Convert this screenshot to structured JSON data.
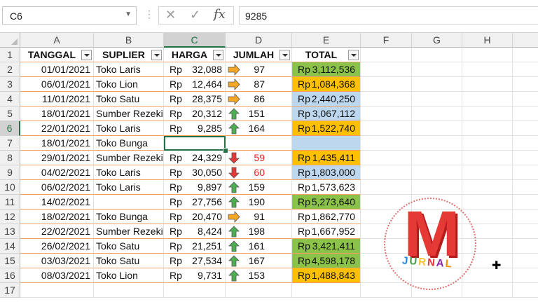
{
  "formula_bar": {
    "name_box": "C6",
    "formula_value": "9285",
    "fx_label": "fx",
    "cancel_icon": "x-icon",
    "enter_icon": "check-icon"
  },
  "columns": [
    "A",
    "B",
    "C",
    "D",
    "E",
    "F",
    "G",
    "H"
  ],
  "rows": [
    "1",
    "2",
    "3",
    "4",
    "5",
    "6",
    "7",
    "8",
    "9",
    "10",
    "11",
    "12",
    "13",
    "14",
    "15",
    "16",
    "17"
  ],
  "headers": {
    "tanggal": "TANGGAL",
    "suplier": "SUPLIER",
    "harga": "HARGA",
    "jumlah": "JUMLAH",
    "total": "TOTAL"
  },
  "currency": "Rp",
  "records": [
    {
      "tanggal": "01/01/2021",
      "suplier": "Toko Laris",
      "harga": "32,088",
      "arrow": "right",
      "jumlah": "97",
      "total": "3,112,536",
      "fill": "green"
    },
    {
      "tanggal": "06/01/2021",
      "suplier": "Toko Lion",
      "harga": "12,464",
      "arrow": "right",
      "jumlah": "87",
      "total": "1,084,368",
      "fill": "orange"
    },
    {
      "tanggal": "11/01/2021",
      "suplier": "Toko Satu",
      "harga": "28,375",
      "arrow": "right",
      "jumlah": "86",
      "total": "2,440,250",
      "fill": "blue"
    },
    {
      "tanggal": "18/01/2021",
      "suplier": "Sumber Rezeki",
      "harga": "20,312",
      "arrow": "up",
      "jumlah": "151",
      "total": "3,067,112",
      "fill": "blue"
    },
    {
      "tanggal": "22/01/2021",
      "suplier": "Toko Laris",
      "harga": "9,285",
      "arrow": "up",
      "jumlah": "164",
      "total": "1,522,740",
      "fill": "orange"
    },
    {
      "tanggal": "18/01/2021",
      "suplier": "Toko Bunga",
      "harga": "",
      "arrow": "",
      "jumlah": "",
      "total": "",
      "fill": "blue"
    },
    {
      "tanggal": "29/01/2021",
      "suplier": "Sumber Rezeki",
      "harga": "24,329",
      "arrow": "down",
      "jumlah": "59",
      "total": "1,435,411",
      "fill": "orange"
    },
    {
      "tanggal": "04/02/2021",
      "suplier": "Toko Laris",
      "harga": "30,050",
      "arrow": "down",
      "jumlah": "60",
      "total": "1,803,000",
      "fill": "blue"
    },
    {
      "tanggal": "06/02/2021",
      "suplier": "Toko Laris",
      "harga": "9,897",
      "arrow": "up",
      "jumlah": "159",
      "total": "1,573,623",
      "fill": "none"
    },
    {
      "tanggal": "14/02/2021",
      "suplier": "",
      "harga": "27,756",
      "arrow": "up",
      "jumlah": "190",
      "total": "5,273,640",
      "fill": "green"
    },
    {
      "tanggal": "18/02/2021",
      "suplier": "Toko Bunga",
      "harga": "20,470",
      "arrow": "right",
      "jumlah": "91",
      "total": "1,862,770",
      "fill": "none"
    },
    {
      "tanggal": "22/02/2021",
      "suplier": "Sumber Rezeki",
      "harga": "8,424",
      "arrow": "up",
      "jumlah": "198",
      "total": "1,667,952",
      "fill": "none"
    },
    {
      "tanggal": "26/02/2021",
      "suplier": "Toko Satu",
      "harga": "21,251",
      "arrow": "up",
      "jumlah": "161",
      "total": "3,421,411",
      "fill": "green"
    },
    {
      "tanggal": "03/03/2021",
      "suplier": "Toko Satu",
      "harga": "27,534",
      "arrow": "up",
      "jumlah": "167",
      "total": "4,598,178",
      "fill": "green"
    },
    {
      "tanggal": "08/03/2021",
      "suplier": "Toko Lion",
      "harga": "9,731",
      "arrow": "up",
      "jumlah": "153",
      "total": "1,488,843",
      "fill": "orange"
    }
  ],
  "active_cell": {
    "row": 5,
    "col": "C"
  },
  "logo": {
    "letter": "M",
    "word": "JURNAL"
  },
  "colors": {
    "green": "#8bc34a",
    "orange": "#ffc000",
    "blue": "#bdd7ee",
    "accent": "#217346",
    "arrow_right": "#f5a623",
    "arrow_up": "#4caf50",
    "arrow_down": "#e53935"
  }
}
